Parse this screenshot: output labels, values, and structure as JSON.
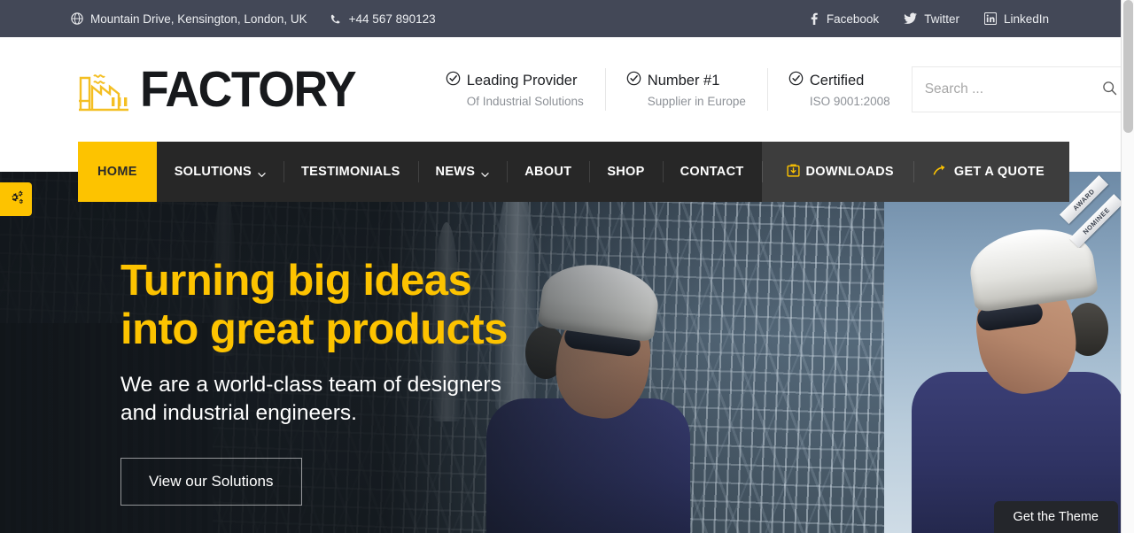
{
  "topbar": {
    "address": "Mountain Drive, Kensington, London, UK",
    "phone": "+44 567 890123",
    "socials": [
      {
        "label": "Facebook",
        "icon": "facebook-icon"
      },
      {
        "label": "Twitter",
        "icon": "twitter-icon"
      },
      {
        "label": "LinkedIn",
        "icon": "linkedin-icon"
      }
    ],
    "address_icon": "globe-icon",
    "phone_icon": "phone-icon"
  },
  "header": {
    "logo_text": "FACTORY",
    "logo_icon": "factory-icon",
    "features": [
      {
        "title": "Leading Provider",
        "sub": "Of Industrial Solutions",
        "icon": "check-circle-icon"
      },
      {
        "title": "Number #1",
        "sub": "Supplier in Europe",
        "icon": "check-circle-icon"
      },
      {
        "title": "Certified",
        "sub": "ISO 9001:2008",
        "icon": "check-circle-icon"
      }
    ],
    "search": {
      "placeholder": "Search ...",
      "value": "",
      "icon": "search-icon"
    }
  },
  "nav": {
    "items": [
      {
        "label": "HOME",
        "active": true,
        "has_dropdown": false
      },
      {
        "label": "SOLUTIONS",
        "active": false,
        "has_dropdown": true
      },
      {
        "label": "TESTIMONIALS",
        "active": false,
        "has_dropdown": false
      },
      {
        "label": "NEWS",
        "active": false,
        "has_dropdown": true
      },
      {
        "label": "ABOUT",
        "active": false,
        "has_dropdown": false
      },
      {
        "label": "SHOP",
        "active": false,
        "has_dropdown": false
      },
      {
        "label": "CONTACT",
        "active": false,
        "has_dropdown": false
      }
    ],
    "actions": [
      {
        "label": "DOWNLOADS",
        "icon": "download-box-icon"
      },
      {
        "label": "GET A QUOTE",
        "icon": "quote-arrow-icon"
      }
    ]
  },
  "hero": {
    "heading_line1": "Turning big ideas",
    "heading_line2": "into great products",
    "sub_line1": "We are a world-class team of designers",
    "sub_line2": "and industrial engineers.",
    "button_label": "View our Solutions"
  },
  "widgets": {
    "gear_tab_icon": "gears-icon",
    "award_line1": "AWARD",
    "award_line2": "NOMINEE",
    "get_theme_label": "Get the Theme"
  },
  "colors": {
    "accent_yellow": "#fdc300",
    "topbar_bg": "#434857",
    "nav_bg": "#272727",
    "nav_actions_bg": "#3d3d3d",
    "logo_text": "#17191c"
  }
}
